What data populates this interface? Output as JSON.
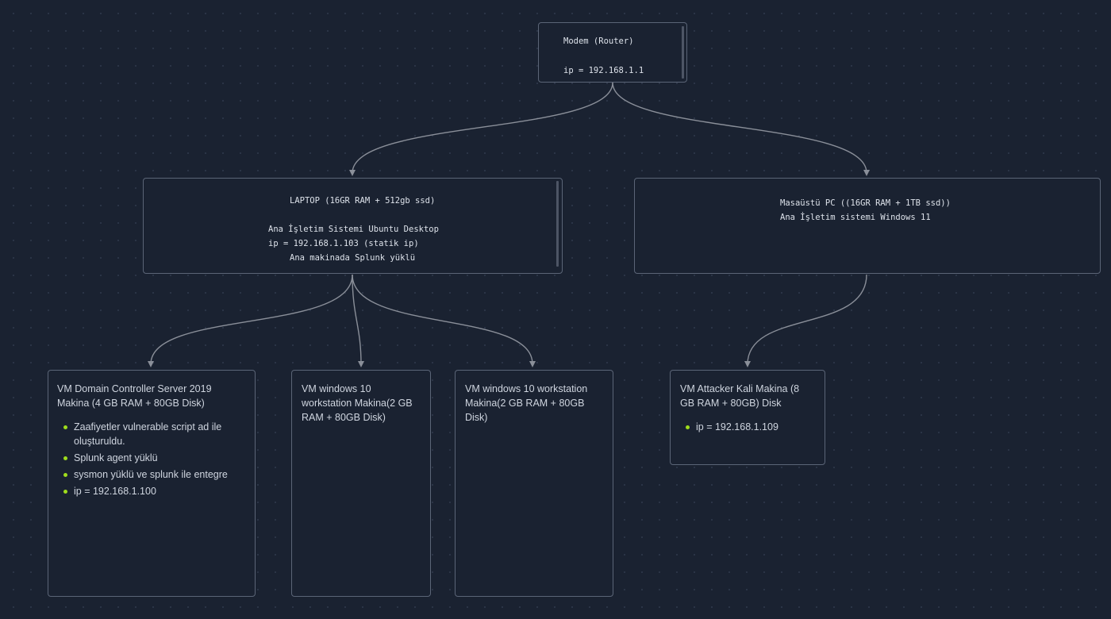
{
  "colors": {
    "background": "#1a2231",
    "node_border": "#5b6577",
    "edge": "#8a8f99",
    "bullet": "#9fdc1c",
    "text": "#d7dbe3"
  },
  "modem": {
    "line1": "Modem (Router)",
    "line2": "ip = 192.168.1.1"
  },
  "laptop": {
    "line1": "LAPTOP (16GR RAM + 512gb ssd)",
    "line2": "Ana İşletim Sistemi Ubuntu Desktop",
    "line3": "ip = 192.168.1.103 (statik ip)",
    "line4": "Ana makinada Splunk yüklü"
  },
  "desktop": {
    "line1": "Masaüstü PC ((16GR RAM + 1TB ssd))",
    "line2": "Ana İşletim sistemi Windows 11"
  },
  "vm_dc": {
    "title": "VM Domain Controller Server 2019 Makina (4 GB RAM + 80GB Disk)",
    "items": [
      "Zaafiyetler vulnerable script ad ile oluşturuldu.",
      "Splunk agent yüklü",
      "sysmon yüklü ve splunk ile entegre",
      "ip = 192.168.1.100"
    ]
  },
  "vm_win1": {
    "title": "VM windows 10 workstation Makina(2 GB RAM + 80GB Disk)"
  },
  "vm_win2": {
    "title": "VM windows 10 workstation Makina(2 GB RAM + 80GB Disk)"
  },
  "vm_kali": {
    "title": "VM Attacker Kali Makina (8 GB RAM + 80GB) Disk",
    "items": [
      "ip = 192.168.1.109"
    ]
  }
}
